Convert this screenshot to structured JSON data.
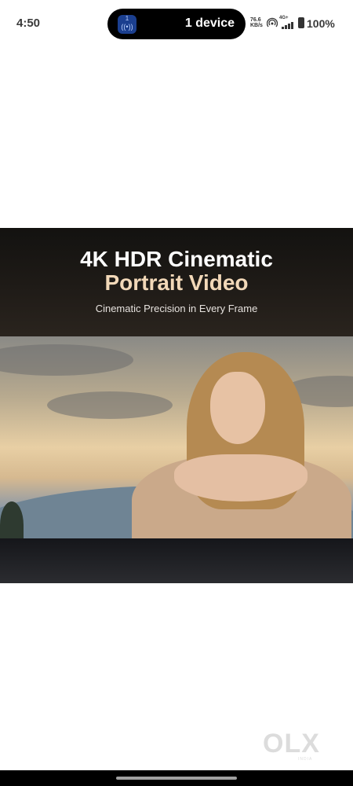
{
  "status_bar": {
    "time": "4:50",
    "pill_icon_count": "1",
    "pill_label": "1 device",
    "net_speed_value": "76.6",
    "net_speed_unit": "KB/s",
    "network_tag": "4G+",
    "battery": "100%",
    "icons": [
      "hotspot-icon",
      "signal-icon",
      "battery-icon"
    ]
  },
  "banner": {
    "title_line1": "4K HDR Cinematic",
    "title_line2": "Portrait Video",
    "subtitle": "Cinematic Precision in Every Frame",
    "accent_color": "#f2d8b8"
  },
  "watermark": {
    "logo": "OLX",
    "sub": "INDIA"
  }
}
